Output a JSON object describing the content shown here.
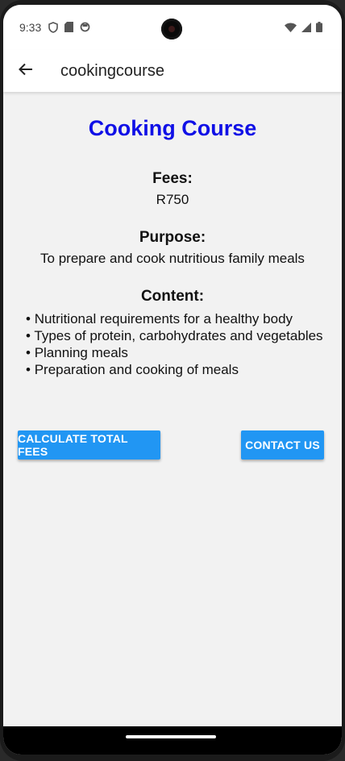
{
  "status_bar": {
    "time": "9:33",
    "icons_left": [
      "shield-icon",
      "sd-card-icon",
      "circle-icon"
    ],
    "icons_right": [
      "wifi-icon",
      "signal-icon",
      "battery-icon"
    ]
  },
  "app_bar": {
    "title": "cookingcourse",
    "back_icon": "arrow-left-icon"
  },
  "course": {
    "title": "Cooking Course",
    "fees_label": "Fees:",
    "fees_value": "R750",
    "purpose_label": "Purpose:",
    "purpose_value": "To prepare and cook nutritious family meals",
    "content_label": "Content:",
    "content_items": [
      "Nutritional requirements for a healthy body",
      "Types of protein, carbohydrates and vegetables",
      "Planning meals",
      "Preparation and cooking of meals"
    ]
  },
  "buttons": {
    "calculate": "CALCULATE TOTAL FEES",
    "contact": "CONTACT US"
  },
  "colors": {
    "title_blue": "#1010e6",
    "button_blue": "#2196f3",
    "background": "#f2f2f2"
  }
}
